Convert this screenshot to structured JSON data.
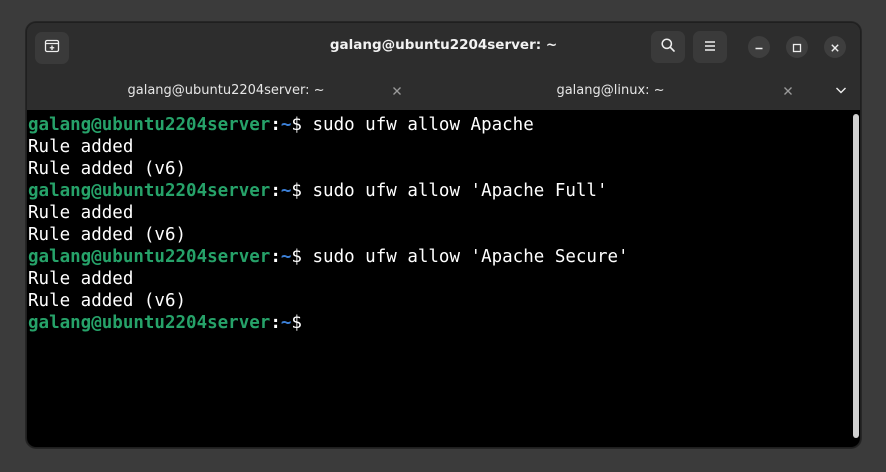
{
  "window": {
    "title": "galang@ubuntu2204server: ~"
  },
  "tabs": [
    {
      "label": "galang@ubuntu2204server: ~",
      "active": true
    },
    {
      "label": "galang@linux: ~",
      "active": false
    }
  ],
  "icons": {
    "new_tab": "new-tab-icon",
    "search": "search-icon",
    "menu": "hamburger-menu-icon",
    "minimize": "minimize-icon",
    "maximize": "maximize-icon",
    "close": "close-icon",
    "tab_close": "close-icon",
    "tabs_dropdown": "chevron-down-icon"
  },
  "colors": {
    "prompt_user": "#26a269",
    "prompt_path": "#3b7fd6",
    "active_tab_indicator": "#3584e4",
    "terminal_bg": "#000000"
  },
  "terminal": {
    "prompt": {
      "user_host": "galang@ubuntu2204server",
      "colon": ":",
      "path": "~",
      "symbol": "$ "
    },
    "lines": [
      {
        "kind": "prompt",
        "command": "sudo ufw allow Apache"
      },
      {
        "kind": "output",
        "text": "Rule added"
      },
      {
        "kind": "output",
        "text": "Rule added (v6)"
      },
      {
        "kind": "prompt",
        "command": "sudo ufw allow 'Apache Full'"
      },
      {
        "kind": "output",
        "text": "Rule added"
      },
      {
        "kind": "output",
        "text": "Rule added (v6)"
      },
      {
        "kind": "prompt",
        "command": "sudo ufw allow 'Apache Secure'"
      },
      {
        "kind": "output",
        "text": "Rule added"
      },
      {
        "kind": "output",
        "text": "Rule added (v6)"
      },
      {
        "kind": "prompt",
        "command": ""
      }
    ]
  }
}
